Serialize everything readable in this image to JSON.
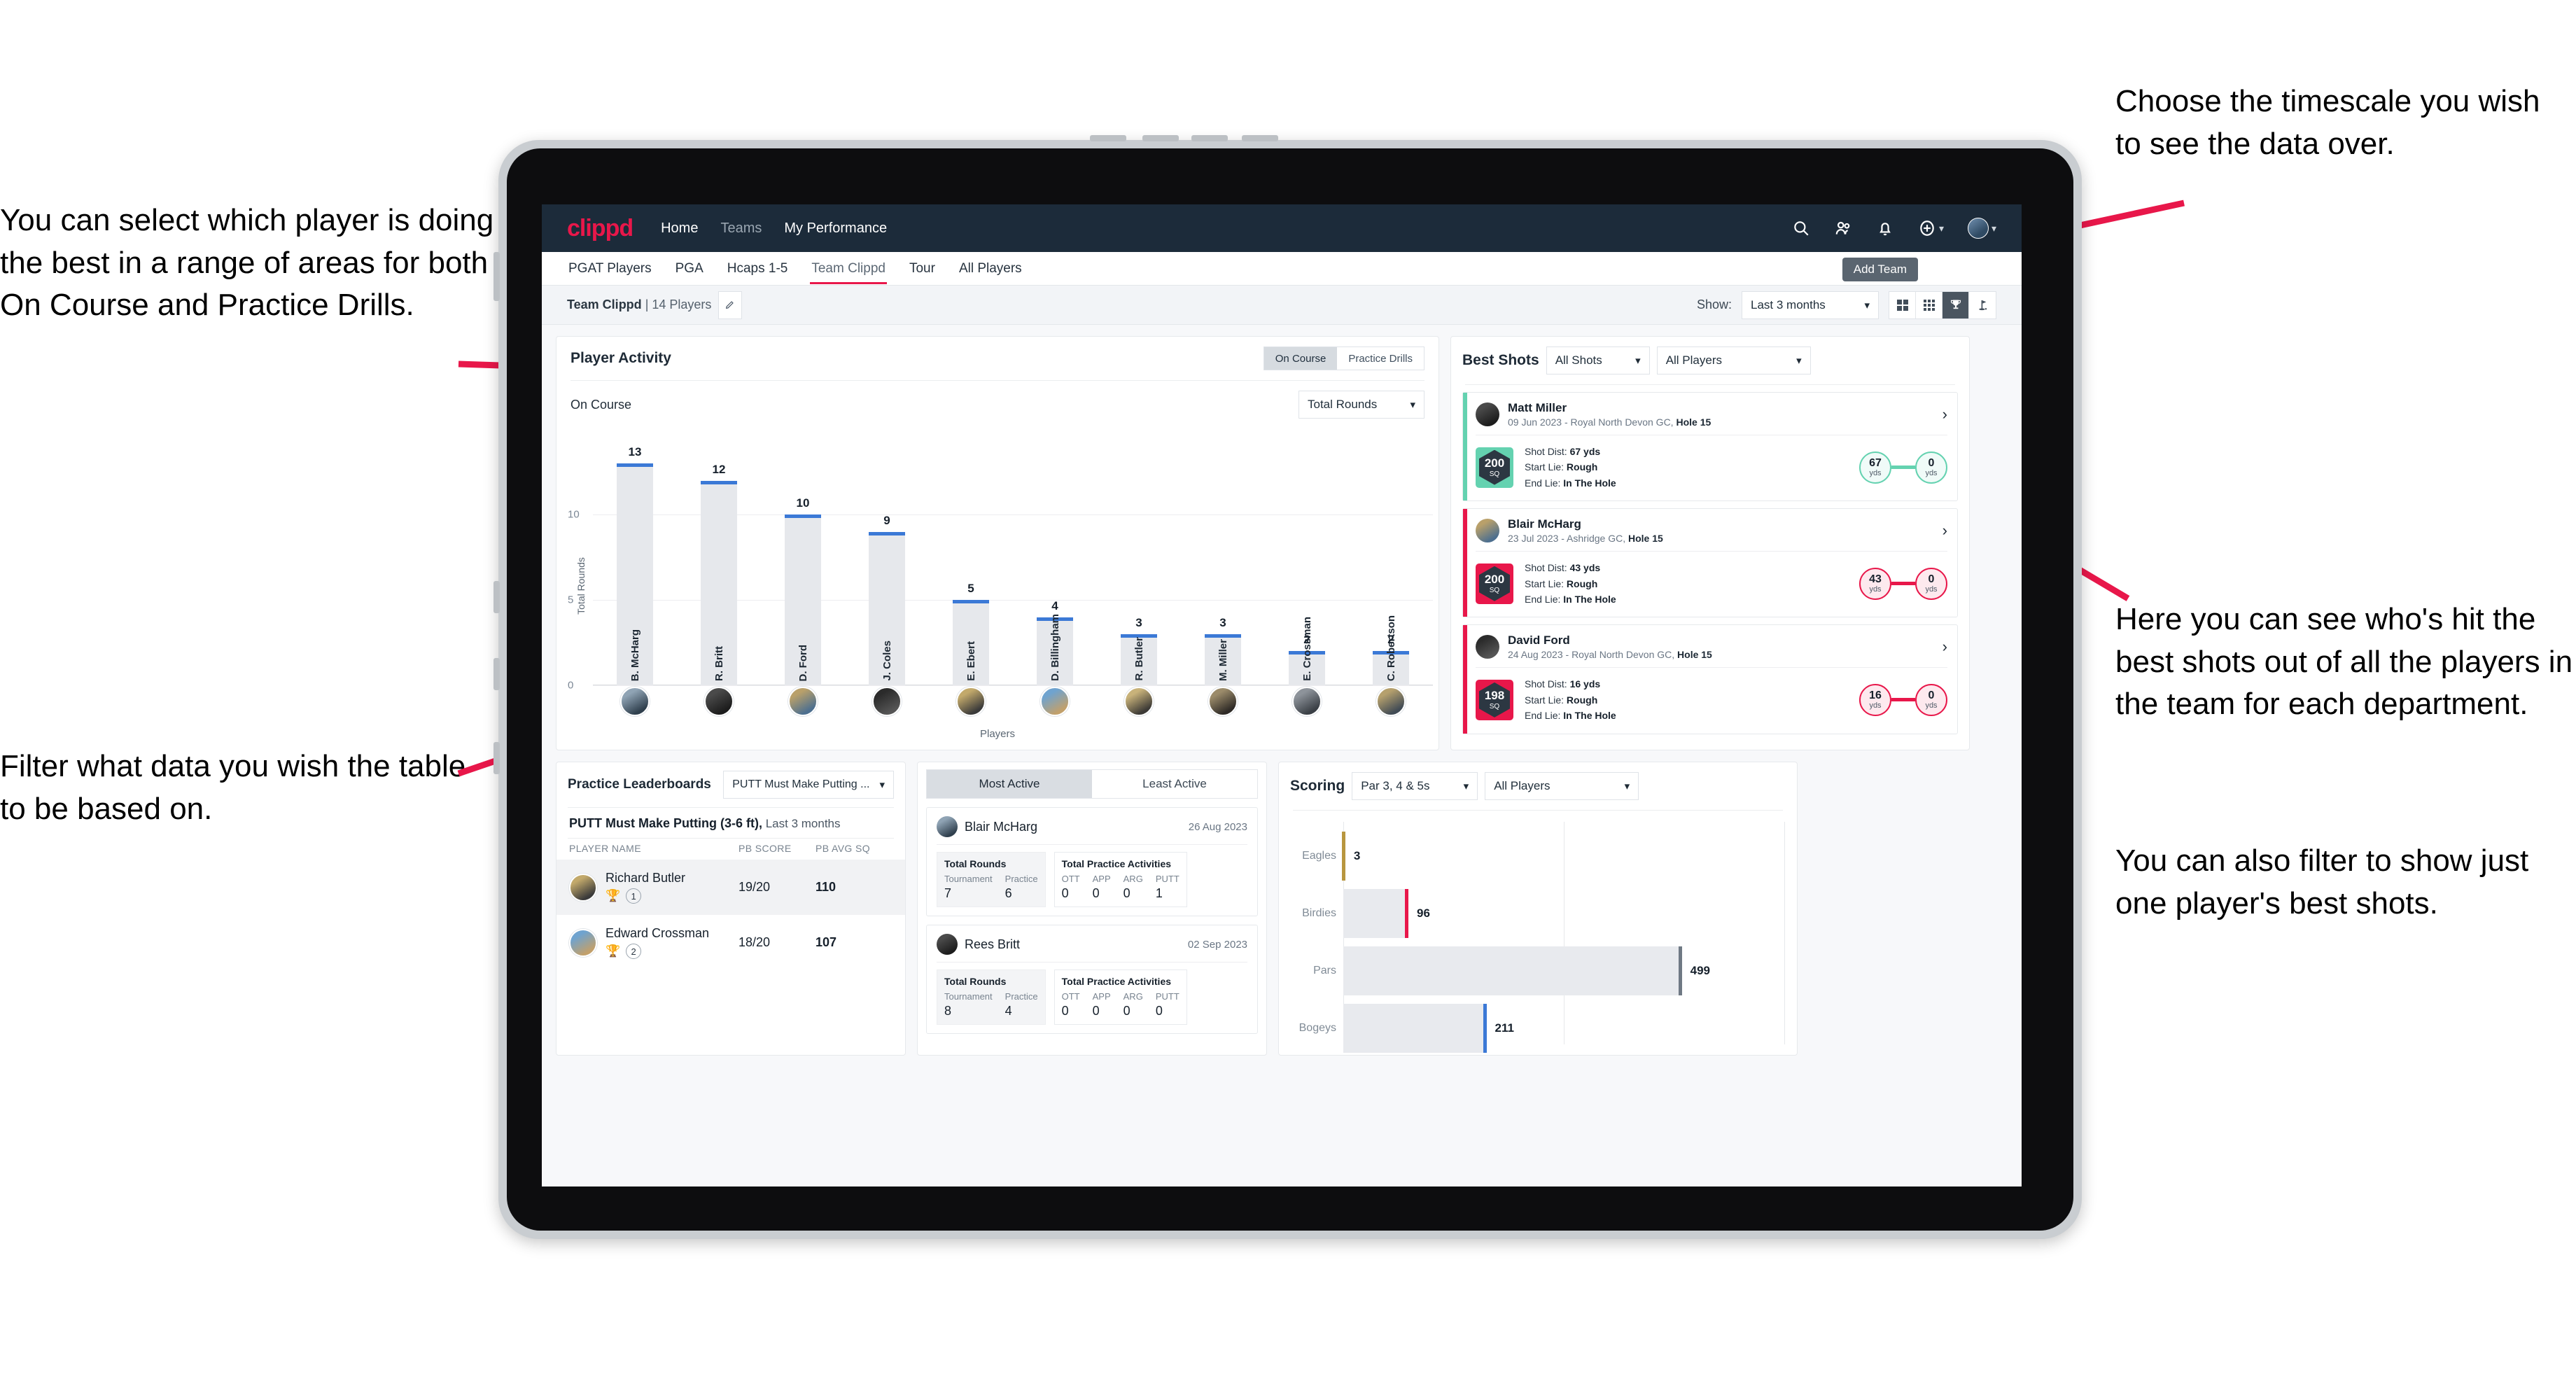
{
  "annotations": {
    "select_player": "You can select which player is doing the best in a range of areas for both On Course and Practice Drills.",
    "filter_table": "Filter what data you wish the table to be based on.",
    "timescale": "Choose the timescale you wish to see the data over.",
    "best_shots": "Here you can see who's hit the best shots out of all the players in the team for each department.",
    "filter_player": "You can also filter to show just one player's best shots."
  },
  "topnav": {
    "logo": "clippd",
    "links": [
      {
        "label": "Home",
        "dim": false
      },
      {
        "label": "Teams",
        "dim": true
      },
      {
        "label": "My Performance",
        "dim": false
      }
    ],
    "icons": [
      "search-icon",
      "people-icon",
      "bell-icon",
      "plus-circle-icon",
      "avatar-icon"
    ]
  },
  "tabs": {
    "items": [
      {
        "label": "PGAT Players",
        "active": false
      },
      {
        "label": "PGA",
        "active": false
      },
      {
        "label": "Hcaps 1-5",
        "active": false
      },
      {
        "label": "Team Clippd",
        "active": true
      },
      {
        "label": "Tour",
        "active": false
      },
      {
        "label": "All Players",
        "active": false
      }
    ],
    "tooltip": "Add Team"
  },
  "filterbar": {
    "team_name": "Team Clippd",
    "separator": " | ",
    "player_count": "14 Players",
    "edit_icon": "pencil-icon",
    "show_label": "Show:",
    "timescale_value": "Last 3 months",
    "views": [
      {
        "icon": "grid-2x2-icon",
        "active": false
      },
      {
        "icon": "grid-3x3-icon",
        "active": false
      },
      {
        "icon": "trophy-icon",
        "active": true
      },
      {
        "icon": "golf-flag-icon",
        "active": false
      }
    ]
  },
  "player_activity": {
    "title": "Player Activity",
    "segments": [
      {
        "label": "On Course",
        "active": true
      },
      {
        "label": "Practice Drills",
        "active": false
      }
    ],
    "sub_label": "On Course",
    "metric_select": "Total Rounds"
  },
  "chart_data": [
    {
      "type": "bar",
      "title": "Player Activity",
      "xlabel": "Players",
      "ylabel": "Total Rounds",
      "categories": [
        "B. McHarg",
        "R. Britt",
        "D. Ford",
        "J. Coles",
        "E. Ebert",
        "D. Billingham",
        "R. Butler",
        "M. Miller",
        "E. Crossman",
        "C. Robertson"
      ],
      "values": [
        13,
        12,
        10,
        9,
        5,
        4,
        3,
        3,
        2,
        2
      ],
      "ylim": [
        0,
        14
      ],
      "yticks": [
        0,
        5,
        10
      ],
      "grid": true,
      "bar_color": "#e6e8ec",
      "cap_color": "#3b79d6"
    },
    {
      "type": "bar",
      "orientation": "horizontal",
      "title": "Scoring",
      "categories": [
        "Eagles",
        "Birdies",
        "Pars",
        "Bogeys"
      ],
      "values": [
        3,
        96,
        499,
        211
      ],
      "colors": [
        "#b8963f",
        "#e8174a",
        "#6f7984",
        "#3b79d6"
      ],
      "xlim": [
        0,
        650
      ],
      "grid": true
    }
  ],
  "best_shots": {
    "title": "Best Shots",
    "shot_filter": "All Shots",
    "player_filter": "All Players",
    "items": [
      {
        "name": "Matt Miller",
        "meta_date": "09 Jun 2023 - Royal North Devon GC, ",
        "meta_hole": "Hole 15",
        "sq": "200",
        "sq_unit": "SQ",
        "accent": "#64d2b0",
        "shot_dist_label": "Shot Dist: ",
        "shot_dist": "67 yds",
        "start_lie_label": "Start Lie: ",
        "start_lie": "Rough",
        "end_lie_label": "End Lie: ",
        "end_lie": "In The Hole",
        "from_val": "67",
        "from_unit": "yds",
        "to_val": "0",
        "to_unit": "yds"
      },
      {
        "name": "Blair McHarg",
        "meta_date": "23 Jul 2023 - Ashridge GC, ",
        "meta_hole": "Hole 15",
        "sq": "200",
        "sq_unit": "SQ",
        "accent": "#e8174a",
        "shot_dist_label": "Shot Dist: ",
        "shot_dist": "43 yds",
        "start_lie_label": "Start Lie: ",
        "start_lie": "Rough",
        "end_lie_label": "End Lie: ",
        "end_lie": "In The Hole",
        "from_val": "43",
        "from_unit": "yds",
        "to_val": "0",
        "to_unit": "yds"
      },
      {
        "name": "David Ford",
        "meta_date": "24 Aug 2023 - Royal North Devon GC, ",
        "meta_hole": "Hole 15",
        "sq": "198",
        "sq_unit": "SQ",
        "accent": "#e8174a",
        "shot_dist_label": "Shot Dist: ",
        "shot_dist": "16 yds",
        "start_lie_label": "Start Lie: ",
        "start_lie": "Rough",
        "end_lie_label": "End Lie: ",
        "end_lie": "In The Hole",
        "from_val": "16",
        "from_unit": "yds",
        "to_val": "0",
        "to_unit": "yds"
      }
    ]
  },
  "practice_leaderboards": {
    "title": "Practice Leaderboards",
    "drill_select": "PUTT Must Make Putting ...",
    "subtitle_bold": "PUTT Must Make Putting (3-6 ft),",
    "subtitle_light": " Last 3 months",
    "columns": [
      "PLAYER NAME",
      "PB SCORE",
      "PB AVG SQ"
    ],
    "rows": [
      {
        "name": "Richard Butler",
        "rank": "1",
        "score": "19/20",
        "avg_sq": "110",
        "trophy": "gold"
      },
      {
        "name": "Edward Crossman",
        "rank": "2",
        "score": "18/20",
        "avg_sq": "107",
        "trophy": "silver"
      }
    ]
  },
  "activity": {
    "tabs": [
      {
        "label": "Most Active",
        "active": true
      },
      {
        "label": "Least Active",
        "active": false
      }
    ],
    "items": [
      {
        "name": "Blair McHarg",
        "date": "26 Aug 2023",
        "rounds_title": "Total Rounds",
        "rounds": [
          {
            "k": "Tournament",
            "v": "7"
          },
          {
            "k": "Practice",
            "v": "6"
          }
        ],
        "practice_title": "Total Practice Activities",
        "practice": [
          {
            "k": "OTT",
            "v": "0"
          },
          {
            "k": "APP",
            "v": "0"
          },
          {
            "k": "ARG",
            "v": "0"
          },
          {
            "k": "PUTT",
            "v": "1"
          }
        ]
      },
      {
        "name": "Rees Britt",
        "date": "02 Sep 2023",
        "rounds_title": "Total Rounds",
        "rounds": [
          {
            "k": "Tournament",
            "v": "8"
          },
          {
            "k": "Practice",
            "v": "4"
          }
        ],
        "practice_title": "Total Practice Activities",
        "practice": [
          {
            "k": "OTT",
            "v": "0"
          },
          {
            "k": "APP",
            "v": "0"
          },
          {
            "k": "ARG",
            "v": "0"
          },
          {
            "k": "PUTT",
            "v": "0"
          }
        ]
      }
    ]
  },
  "scoring": {
    "title": "Scoring",
    "par_select": "Par 3, 4 & 5s",
    "player_select": "All Players"
  }
}
